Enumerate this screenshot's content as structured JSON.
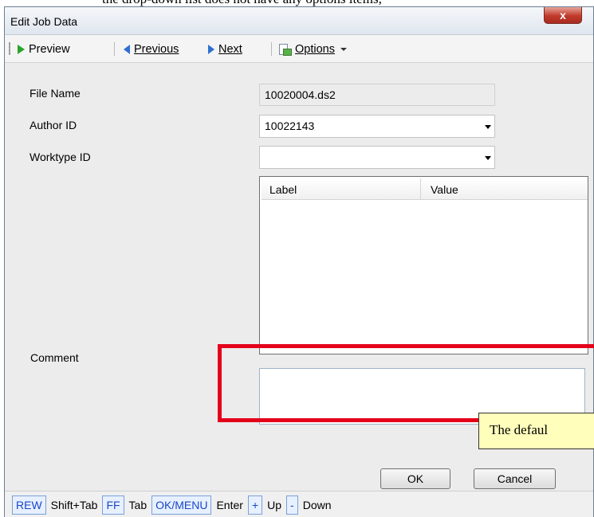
{
  "document_fragment": {
    "clipped_text": "the drop-down list does not have any options items,"
  },
  "window": {
    "title": "Edit Job Data",
    "close_label": "x"
  },
  "toolbar": {
    "preview_label": "Preview",
    "previous_label": "Previous",
    "next_label": "Next",
    "options_label": "Options"
  },
  "form": {
    "file_name_label": "File Name",
    "file_name_value": "10020004.ds2",
    "author_id_label": "Author ID",
    "author_id_value": "10022143",
    "worktype_id_label": "Worktype ID",
    "worktype_id_value": "",
    "comment_label": "Comment",
    "comment_value": ""
  },
  "grid": {
    "columns": [
      "Label",
      "Value"
    ],
    "rows": []
  },
  "tooltip": {
    "text": "The defaul"
  },
  "buttons": {
    "ok_label": "OK",
    "cancel_label": "Cancel"
  },
  "statusbar": {
    "shortcuts": [
      {
        "key": "REW",
        "action": "Shift+Tab"
      },
      {
        "key": "FF",
        "action": "Tab"
      },
      {
        "key": "OK/MENU",
        "action": "Enter"
      },
      {
        "key": "+",
        "action": "Up"
      },
      {
        "key": "-",
        "action": "Down"
      }
    ]
  },
  "colors": {
    "highlight_red": "#e4001b",
    "tooltip_bg": "#ffffbb",
    "key_blue": "#1a46c8",
    "preview_green": "#2aa52a"
  },
  "icons": {
    "preview": "play-triangle-icon",
    "previous": "arrow-left-icon",
    "next": "arrow-right-icon",
    "options": "options-sheet-icon",
    "combo": "chevron-down-icon"
  }
}
